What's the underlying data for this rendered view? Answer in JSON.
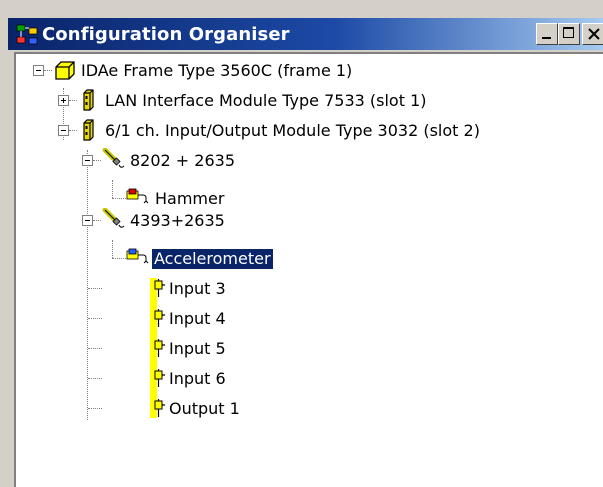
{
  "window": {
    "title": "Configuration Organiser",
    "controls": [
      "minimize",
      "maximize",
      "close"
    ],
    "title_gradient_start": "#0a246a",
    "title_gradient_end": "#a6caf0"
  },
  "tree": {
    "frame": {
      "label": "IDAe Frame Type 3560C (frame 1)",
      "icon": "frame-cube-icon",
      "expanded": true
    },
    "lan_module": {
      "label": "LAN Interface Module Type 7533 (slot 1)",
      "icon": "module-icon",
      "expanded": false
    },
    "io_module": {
      "label": "6/1 ch. Input/Output Module Type 3032 (slot 2)",
      "icon": "module-icon",
      "expanded": true
    },
    "transducer_1": {
      "label": "8202 + 2635",
      "icon": "transducer-probe-icon",
      "expanded": true
    },
    "hammer": {
      "label": "Hammer",
      "icon": "connector-red-icon"
    },
    "transducer_2": {
      "label": "4393+2635",
      "icon": "transducer-probe-icon",
      "expanded": true
    },
    "accelerometer": {
      "label": "Accelerometer",
      "icon": "connector-blue-icon",
      "selected": true
    },
    "inputs": [
      {
        "label": "Input 3",
        "icon": "channel-input-icon"
      },
      {
        "label": "Input 4",
        "icon": "channel-input-icon"
      },
      {
        "label": "Input 5",
        "icon": "channel-input-icon"
      },
      {
        "label": "Input 6",
        "icon": "channel-input-icon"
      },
      {
        "label": "Output 1",
        "icon": "channel-output-icon"
      }
    ]
  },
  "colors": {
    "selection": "#0a246a",
    "channel_yellow": "#ffff00",
    "module_yellow": "#e8d800"
  }
}
